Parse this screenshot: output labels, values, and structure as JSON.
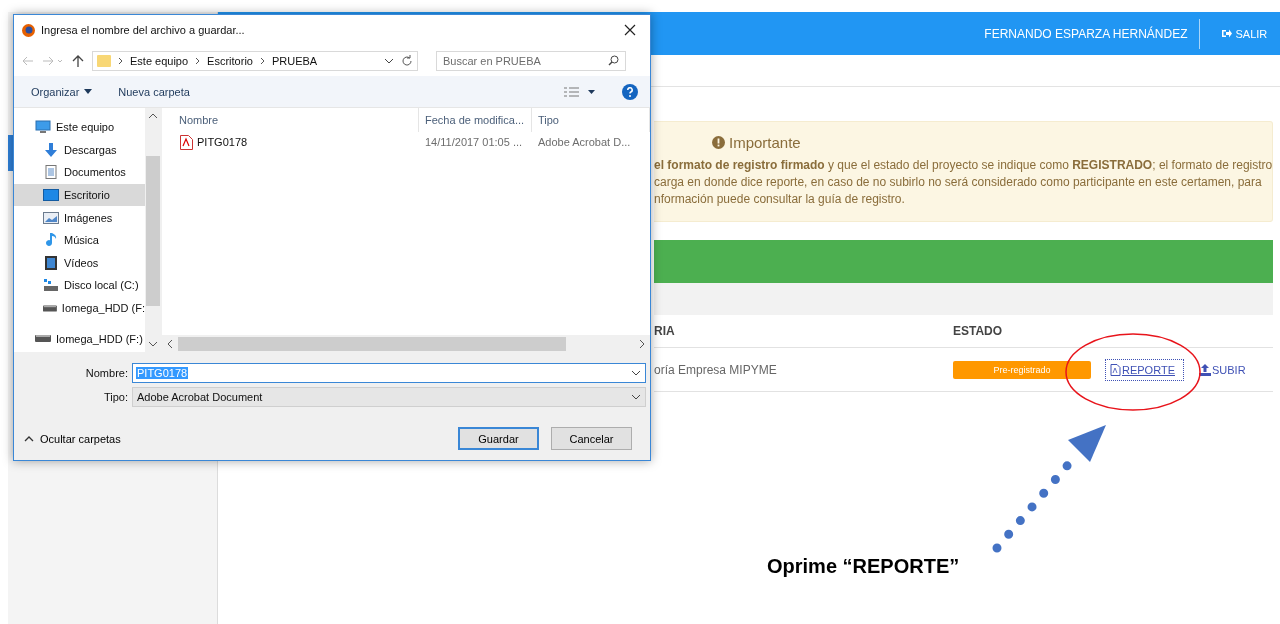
{
  "page": {
    "header": {
      "user": "FERNANDO ESPARZA HERNÁNDEZ",
      "logout": "SALIR"
    },
    "alert": {
      "title": "Importante",
      "lines": [
        "**el formato de registro firmado** y que el estado del proyecto se indique como **REGISTRADO**; el formato de registro",
        "carga en donde dice reporte, en caso de no subirlo no será considerado como participante en este certamen, para",
        "nformación puede consultar la guía de registro."
      ]
    },
    "table": {
      "columns": [
        "RIA",
        "ESTADO"
      ],
      "rows": [
        {
          "category": "oría Empresa MIPYME",
          "status": "Pre-registrado",
          "actions": [
            {
              "kind": "report",
              "label": "REPORTE",
              "focused": true
            },
            {
              "kind": "upload",
              "label": "SUBIR",
              "focused": false
            }
          ]
        }
      ]
    }
  },
  "dialog": {
    "title": "Ingresa el nombre del archivo a guardar...",
    "breadcrumb": [
      "Este equipo",
      "Escritorio",
      "PRUEBA"
    ],
    "search": {
      "placeholder": "Buscar en PRUEBA"
    },
    "toolbar": [
      "Organizar",
      "Nueva carpeta"
    ],
    "nav": [
      {
        "label": "Este equipo",
        "kind": "computer",
        "selected": false,
        "children": [
          {
            "label": "Descargas",
            "kind": "download",
            "selected": false
          },
          {
            "label": "Documentos",
            "kind": "document",
            "selected": false
          },
          {
            "label": "Escritorio",
            "kind": "desktop",
            "selected": true
          },
          {
            "label": "Imágenes",
            "kind": "images",
            "selected": false
          },
          {
            "label": "Música",
            "kind": "music",
            "selected": false
          },
          {
            "label": "Vídeos",
            "kind": "video",
            "selected": false
          },
          {
            "label": "Disco local (C:)",
            "kind": "disk",
            "selected": false
          },
          {
            "label": "Iomega_HDD (F:",
            "kind": "drive",
            "selected": false
          }
        ]
      },
      {
        "label": "Iomega_HDD (F:)",
        "kind": "drive",
        "selected": false
      }
    ],
    "columns": [
      "Nombre",
      "Fecha de modifica...",
      "Tipo"
    ],
    "files": [
      {
        "name": "PITG0178",
        "date": "14/11/2017 01:05 ...",
        "type": "Adobe Acrobat D..."
      }
    ],
    "filename": {
      "label": "Nombre:",
      "value": "PITG0178"
    },
    "filetype": {
      "label": "Tipo:",
      "value": "Adobe Acrobat Document"
    },
    "buttons": [
      {
        "label": "Guardar",
        "default": true
      },
      {
        "label": "Cancelar",
        "default": false
      }
    ],
    "hide_folders": "Ocultar carpetas"
  },
  "annotation": {
    "caption": "Oprime “REPORTE”"
  }
}
